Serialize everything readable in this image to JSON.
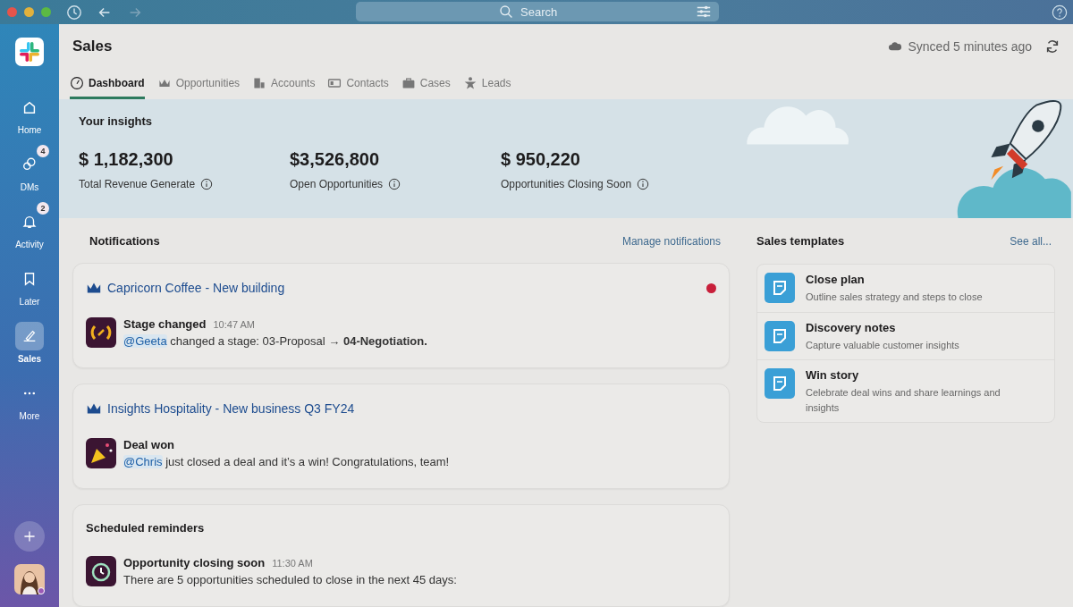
{
  "window": {
    "search": {
      "placeholder": "Search"
    }
  },
  "sidebar": {
    "items": [
      {
        "label": "Home",
        "kind": "home",
        "selected": false
      },
      {
        "label": "DMs",
        "kind": "dms",
        "badge": "4",
        "selected": false
      },
      {
        "label": "Activity",
        "kind": "activity",
        "badge": "2",
        "selected": false
      },
      {
        "label": "Later",
        "kind": "later",
        "selected": false
      },
      {
        "label": "Sales",
        "kind": "sales",
        "selected": true
      },
      {
        "label": "More",
        "kind": "more",
        "selected": false
      }
    ]
  },
  "page": {
    "title": "Sales",
    "sync_status": "Synced 5 minutes ago"
  },
  "tabs": [
    {
      "label": "Dashboard",
      "kind": "dashboard",
      "selected": true
    },
    {
      "label": "Opportunities",
      "kind": "opportunities",
      "selected": false
    },
    {
      "label": "Accounts",
      "kind": "accounts",
      "selected": false
    },
    {
      "label": "Contacts",
      "kind": "contacts",
      "selected": false
    },
    {
      "label": "Cases",
      "kind": "cases",
      "selected": false
    },
    {
      "label": "Leads",
      "kind": "leads",
      "selected": false
    }
  ],
  "insights": {
    "title": "Your insights",
    "metrics": [
      {
        "value": "$ 1,182,300",
        "label": "Total Revenue Generate"
      },
      {
        "value": "$3,526,800",
        "label": "Open Opportunities"
      },
      {
        "value": "$ 950,220",
        "label": "Opportunities Closing Soon"
      }
    ]
  },
  "notifications": {
    "title": "Notifications",
    "manage_link": "Manage notifications",
    "items": [
      {
        "title": "Capricorn Coffee - New building",
        "unread": true,
        "kind": "stage",
        "event": "Stage changed",
        "time": "10:47 AM",
        "mention": "@Geeta",
        "message": " changed a stage: 03-Proposal → **04-Negotiation.**"
      },
      {
        "title": "Insights Hospitality - New business Q3 FY24",
        "unread": false,
        "kind": "won",
        "event": "Deal won",
        "mention": "@Chris",
        "message": " just closed a deal and it’s a win! Congratulations, team!"
      }
    ]
  },
  "reminders": {
    "title": "Scheduled reminders",
    "items": [
      {
        "event": "Opportunity closing soon",
        "time": "11:30 AM",
        "message": "There are 5 opportunities scheduled to close in the next 45 days:"
      }
    ]
  },
  "templates": {
    "title": "Sales templates",
    "see_all": "See all...",
    "items": [
      {
        "title": "Close plan",
        "description": "Outline sales strategy and steps to close"
      },
      {
        "title": "Discovery notes",
        "description": "Capture valuable customer insights"
      },
      {
        "title": "Win story",
        "description": "Celebrate deal wins and share learnings and insights"
      }
    ]
  }
}
